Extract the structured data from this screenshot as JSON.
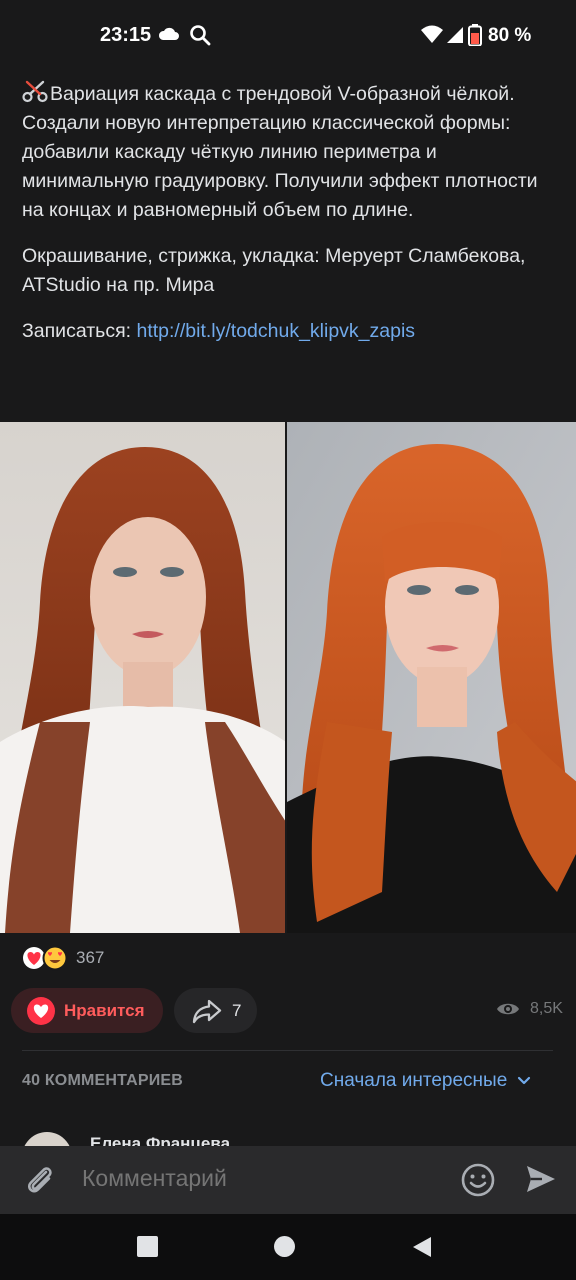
{
  "status_bar": {
    "time": "23:15",
    "battery_text": "80 %",
    "icons": [
      "cloud-icon",
      "search-icon",
      "wifi-icon",
      "signal-icon",
      "battery-icon"
    ]
  },
  "post": {
    "title_line": "Вариация каскада с трендовой V-образной чёлкой.",
    "paragraph": "Создали новую интерпретацию классической формы: добавили каскаду чёткую линию периметра и минимальную градуировку. Получили эффект плотности на концах и равномерный объем по длине.",
    "credits": "Окрашивание, стрижка, укладка: Меруерт Сламбекова, ATStudio на пр. Мира",
    "signup_label": "Записаться: ",
    "signup_link": "http://bit.ly/todchuk_klipvk_zapis"
  },
  "reactions": {
    "count": "367"
  },
  "actions": {
    "like_label": "Нравится",
    "share_count": "7",
    "views_count": "8,5K"
  },
  "comments": {
    "header": "40 КОММЕНТАРИЕВ",
    "sort_label": "Сначала интересные",
    "first_author": "Елена Францева"
  },
  "comment_bar": {
    "placeholder": "Комментарий"
  },
  "colors": {
    "background": "#19191a",
    "link": "#71aaeb",
    "like": "#ff5c5c",
    "hair": "#c8501e"
  }
}
